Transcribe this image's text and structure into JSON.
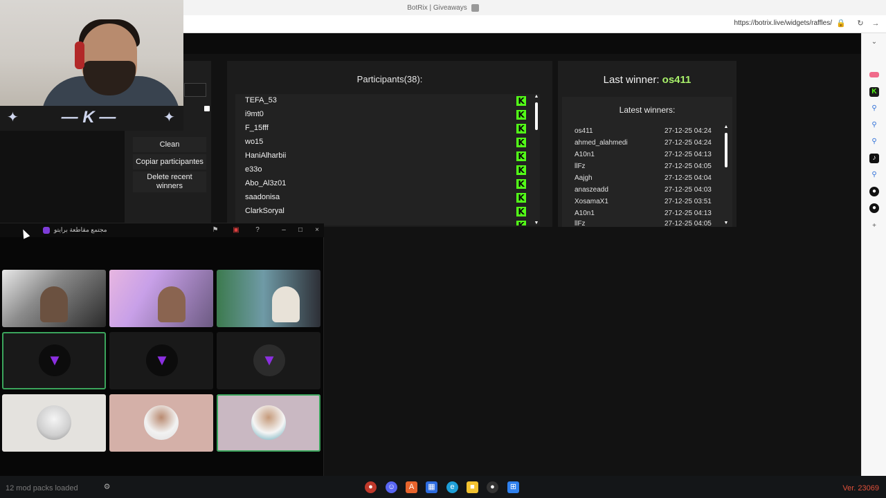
{
  "browser": {
    "tab_title": "BotRix | Giveaways",
    "url": "https://botrix.live/widgets/raffles/"
  },
  "left_panel": {
    "clean_label": "Clean",
    "copy_label": "Copiar participantes",
    "delete_label": "Delete recent winners"
  },
  "participants": {
    "title": "Participant(38):",
    "title_display": "Participants(38):",
    "items": [
      {
        "name": "TEFA_53"
      },
      {
        "name": "i9mt0"
      },
      {
        "name": "F_15fff"
      },
      {
        "name": "wo15"
      },
      {
        "name": "HaniAlharbii"
      },
      {
        "name": "e33o"
      },
      {
        "name": "Abo_Al3z01"
      },
      {
        "name": "saadonisa"
      },
      {
        "name": "ClarkSoryal"
      }
    ]
  },
  "winners": {
    "last_winner_label": "Last winner:",
    "last_winner_name": "os411",
    "latest_title": "Latest winners:",
    "rows": [
      {
        "name": "os411",
        "date": "27-12-25 04:24"
      },
      {
        "name": "ahmed_alahmedi",
        "date": "27-12-25 04:24"
      },
      {
        "name": "A10n1",
        "date": "27-12-25 04:13"
      },
      {
        "name": "llFz",
        "date": "27-12-25 04:05"
      },
      {
        "name": "Aajgh",
        "date": "27-12-25 04:04"
      },
      {
        "name": "anaszeadd",
        "date": "27-12-25 04:03"
      },
      {
        "name": "XosamaX1",
        "date": "27-12-25 03:51"
      },
      {
        "name": "A10n1",
        "date": "27-12-25 04:13"
      },
      {
        "name": "llFz",
        "date": "27-12-25 04:05"
      }
    ]
  },
  "call_window": {
    "title": "مجتمع مقاطعة برايتو"
  },
  "taskbar": {
    "mods_text": "12 mod packs loaded",
    "version": "Ver. 23069"
  },
  "colors": {
    "kick_green": "#53fc18",
    "winner_green": "#a8f06a",
    "speaking_green": "#3ba55c"
  }
}
